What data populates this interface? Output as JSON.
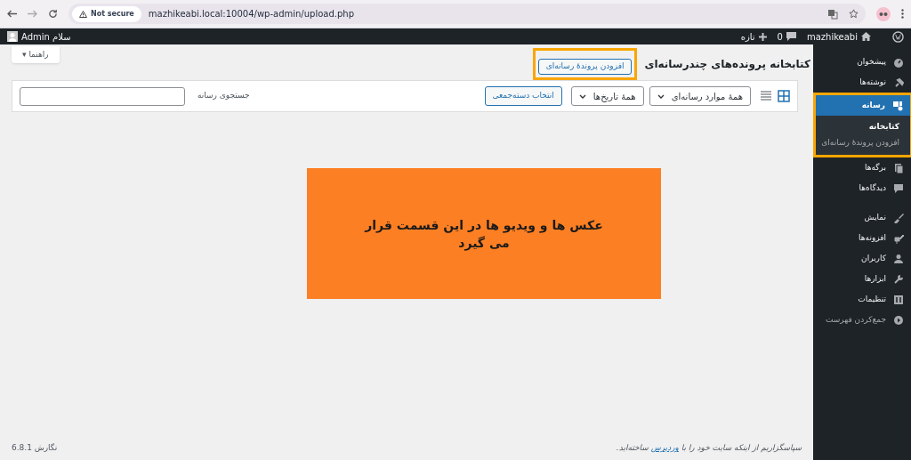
{
  "browser": {
    "security": "Not secure",
    "url": "mazhikeabi.local:10004/wp-admin/upload.php"
  },
  "admin_bar": {
    "site": "mazhikeabi",
    "comments": "0",
    "new": "تازه",
    "greeting": "سلام Admin"
  },
  "sidebar": {
    "items": [
      {
        "label": "پیشخوان",
        "selected": false,
        "highlighted": false,
        "kind": "item"
      },
      {
        "label": "نوشته‌ها",
        "selected": false,
        "highlighted": false,
        "kind": "item"
      },
      {
        "label": "رسانه",
        "selected": true,
        "highlighted": true,
        "kind": "item",
        "children": [
          {
            "label": "کتابخانه",
            "selected": true
          },
          {
            "label": "افزودن پروندهٔ رسانه‌ای",
            "selected": false
          }
        ]
      },
      {
        "label": "برگه‌ها",
        "selected": false,
        "highlighted": false,
        "kind": "item"
      },
      {
        "label": "دیدگاه‌ها",
        "selected": false,
        "highlighted": false,
        "kind": "item"
      },
      {
        "label": "نمایش",
        "selected": false,
        "highlighted": false,
        "kind": "item"
      },
      {
        "label": "افزونه‌ها",
        "selected": false,
        "highlighted": false,
        "kind": "item"
      },
      {
        "label": "کاربران",
        "selected": false,
        "highlighted": false,
        "kind": "item"
      },
      {
        "label": "ابزارها",
        "selected": false,
        "highlighted": false,
        "kind": "item"
      },
      {
        "label": "تنظیمات",
        "selected": false,
        "highlighted": false,
        "kind": "item"
      },
      {
        "label": "جمع‌کردن فهرست",
        "selected": false,
        "highlighted": false,
        "kind": "collapse"
      }
    ]
  },
  "help_tab": "راهنما ▾",
  "page": {
    "title": "کتابخانه پرونده‌های چندرسانه‌ای",
    "add_button": "افزودن پروندهٔ رسانه‌ای",
    "add_highlighted": true
  },
  "toolbar": {
    "grid_selected": true,
    "type_filter": "همهٔ موارد رسانه‌ای",
    "date_filter": "همهٔ تاریخ‌ها",
    "bulk_select": "انتخاب دسته‌جمعی",
    "search_label": "جستجوی رسانه"
  },
  "placeholder_block": "عکس ها و ویدیو ها در این قسمت قرار می گیرد",
  "footer": {
    "thanks_before": "سپاسگزاریم از اینکه سایت خود را با",
    "thanks_link": "وردپرس",
    "thanks_after": "ساخته‌اید.",
    "version": "نگارش 6.8.1"
  }
}
